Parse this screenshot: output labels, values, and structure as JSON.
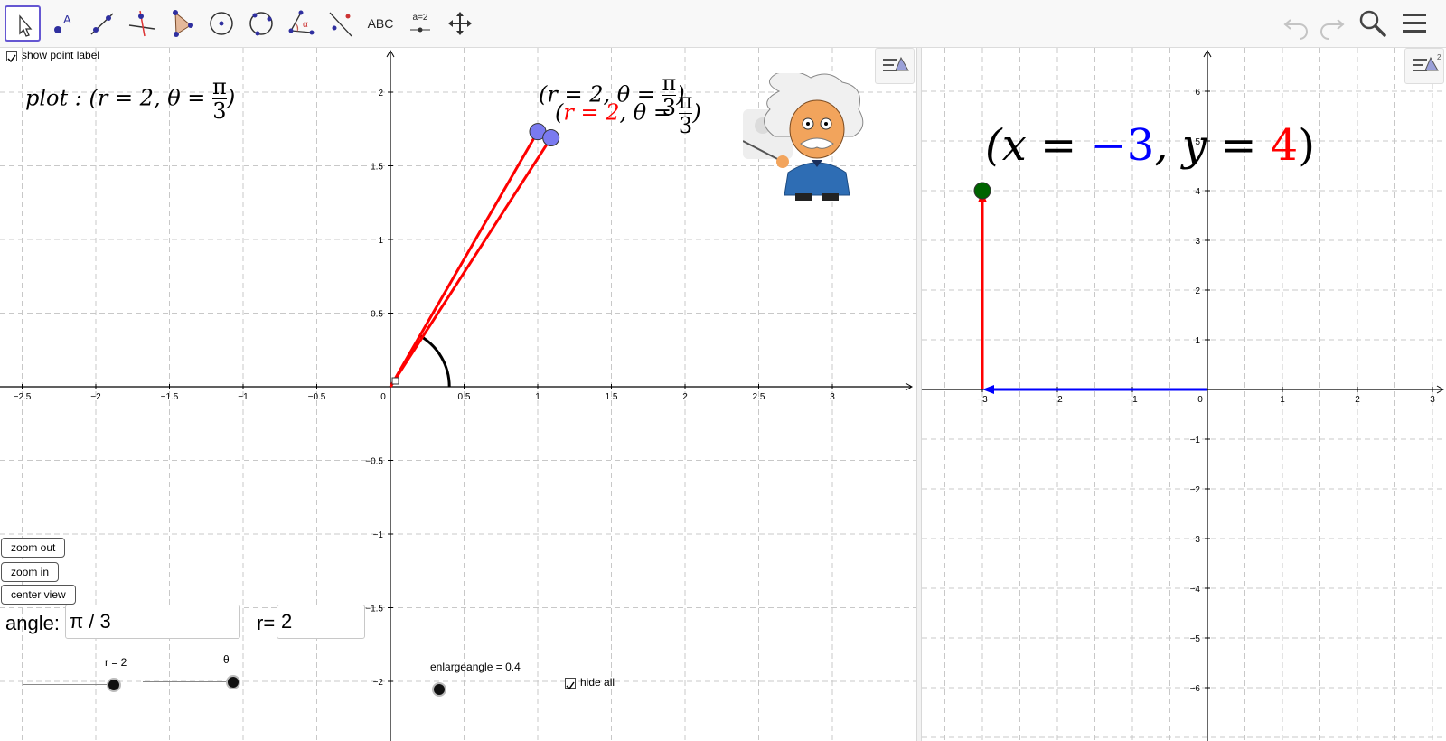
{
  "toolbar": {
    "tools": [
      {
        "name": "move-tool",
        "selected": true
      },
      {
        "name": "point-tool",
        "label": "A"
      },
      {
        "name": "line-tool"
      },
      {
        "name": "perpendicular-tool"
      },
      {
        "name": "polygon-tool"
      },
      {
        "name": "circle-tool"
      },
      {
        "name": "circle-through-points-tool"
      },
      {
        "name": "angle-tool",
        "label": "α"
      },
      {
        "name": "reflect-tool"
      },
      {
        "name": "text-tool",
        "label": "ABC"
      },
      {
        "name": "slider-tool",
        "label": "a=2"
      },
      {
        "name": "move-view-tool"
      }
    ],
    "undo_icon": "undo-icon",
    "redo_icon": "redo-icon",
    "search_icon": "search-icon",
    "menu_icon": "menu-icon"
  },
  "left_view": {
    "show_point_label": {
      "checked": true,
      "label": "show point label"
    },
    "plot_text": "plot : (r = 2, θ = π/3)",
    "point_label_1": "(r = 2, θ = π/3)",
    "point_label_2_parts": [
      "(",
      "r = 2",
      ", θ = π/3)"
    ],
    "x_ticks": [
      "−2.5",
      "−2",
      "−1.5",
      "−1",
      "−0.5",
      "0",
      "0.5",
      "1",
      "1.5",
      "2",
      "2.5",
      "3"
    ],
    "y_ticks": [
      "2",
      "1.5",
      "1",
      "0.5",
      "−0.5",
      "−1",
      "−1.5",
      "−2"
    ],
    "buttons": {
      "zoom_out": "zoom out",
      "zoom_in": "zoom in",
      "center_view": "center view"
    },
    "angle_label": "angle:",
    "angle_value": "π / 3",
    "r_label": "r=",
    "r_value": "2",
    "slider_r_label": "r = 2",
    "slider_theta_label": "θ",
    "slider_enlarge_label": "enlargeangle = 0.4",
    "hide_all": {
      "checked": true,
      "label": "hide all"
    },
    "colors": {
      "segment": "#ff0000",
      "point": "#7a7af0",
      "angle_arc": "#000000"
    }
  },
  "right_view": {
    "equation_parts": [
      "(x = ",
      "−3",
      ", y = ",
      "4",
      ")"
    ],
    "x_ticks": [
      "−3",
      "−2",
      "−1",
      "0",
      "1",
      "2",
      "3"
    ],
    "y_ticks": [
      "6",
      "5",
      "4",
      "3",
      "2",
      "1",
      "−1",
      "−2",
      "−3",
      "−4",
      "−5",
      "−6"
    ],
    "colors": {
      "x_vector": "#0000ff",
      "y_vector": "#ff0000",
      "point": "#006400"
    }
  },
  "mascot_icon": "einstein-teacher-icon"
}
